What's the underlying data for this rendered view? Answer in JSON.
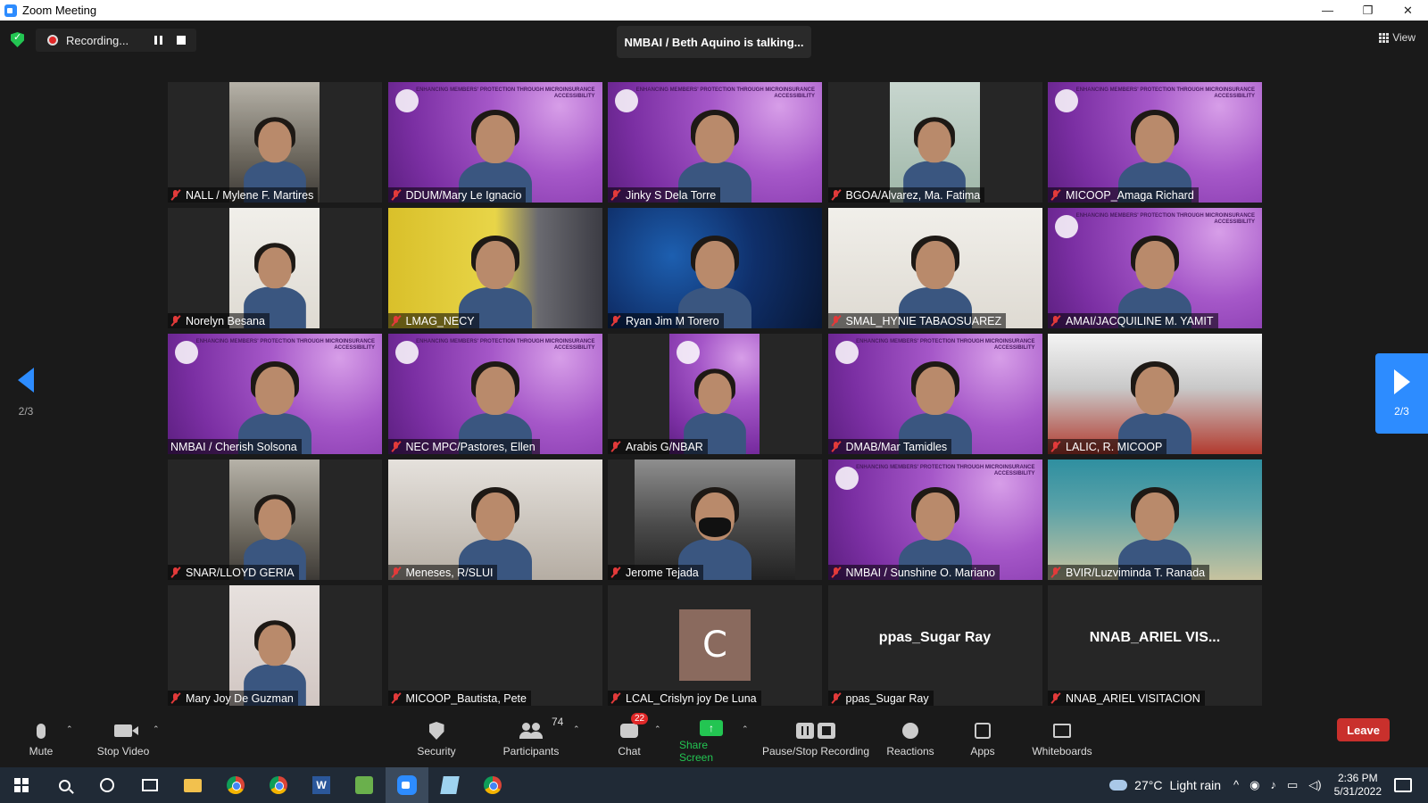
{
  "window": {
    "title": "Zoom Meeting",
    "controls": [
      "—",
      "❐",
      "✕"
    ]
  },
  "recording": {
    "label": "Recording..."
  },
  "talking": {
    "text": "NMBAI / Beth Aquino is talking..."
  },
  "view": {
    "label": "View"
  },
  "pagination": {
    "left_page": "2/3",
    "right_page": "2/3"
  },
  "participants": [
    {
      "name": "NALL / Mylene F. Martires",
      "muted": true,
      "bg": "office",
      "frame": "narrow"
    },
    {
      "name": "DDUM/Mary Le Ignacio",
      "muted": true,
      "bg": "purple",
      "frame": "full"
    },
    {
      "name": "Jinky S Dela Torre",
      "muted": true,
      "bg": "purple",
      "frame": "full"
    },
    {
      "name": "BGOA/Alvarez, Ma. Fatima",
      "muted": true,
      "bg": "mint",
      "frame": "narrow"
    },
    {
      "name": "MICOOP_Amaga Richard",
      "muted": true,
      "bg": "purple",
      "frame": "full"
    },
    {
      "name": "Norelyn Besana",
      "muted": true,
      "bg": "light",
      "frame": "narrow"
    },
    {
      "name": "LMAG_NECY",
      "muted": true,
      "bg": "yellow",
      "frame": "full"
    },
    {
      "name": "Ryan Jim M Torero",
      "muted": true,
      "bg": "tech",
      "frame": "full"
    },
    {
      "name": "SMAL_HYNIE TABAOSUAREZ",
      "muted": true,
      "bg": "light",
      "frame": "full"
    },
    {
      "name": "AMAI/JACQUILINE M. YAMIT",
      "muted": true,
      "bg": "purple",
      "frame": "full"
    },
    {
      "name": "NMBAI / Cherish Solsona",
      "muted": false,
      "bg": "purple",
      "frame": "full"
    },
    {
      "name": "NEC MPC/Pastores, Ellen",
      "muted": true,
      "bg": "purple",
      "frame": "full"
    },
    {
      "name": "Arabis G/NBAR",
      "muted": true,
      "bg": "purple",
      "frame": "narrow"
    },
    {
      "name": "DMAB/Mar Tamidles",
      "muted": true,
      "bg": "purple",
      "frame": "full"
    },
    {
      "name": "LALIC, R. MICOOP",
      "muted": true,
      "bg": "red",
      "frame": "full"
    },
    {
      "name": "SNAR/LLOYD GERIA",
      "muted": true,
      "bg": "office",
      "frame": "narrow"
    },
    {
      "name": "Meneses, R/SLUI",
      "muted": true,
      "bg": "room",
      "frame": "full"
    },
    {
      "name": "Jerome Tejada",
      "muted": true,
      "bg": "car",
      "frame": "mid"
    },
    {
      "name": "NMBAI / Sunshine O. Mariano",
      "muted": true,
      "bg": "purple",
      "frame": "full"
    },
    {
      "name": "BVIR/Luzviminda T. Ranada",
      "muted": true,
      "bg": "teal",
      "frame": "full"
    },
    {
      "name": "Mary Joy De Guzman",
      "muted": true,
      "bg": "pink",
      "frame": "narrow"
    },
    {
      "name": "MICOOP_Bautista, Pete",
      "muted": true,
      "bg": "none",
      "frame": "none"
    },
    {
      "name": "LCAL_Crislyn joy De Luna",
      "muted": true,
      "bg": "none",
      "frame": "avatar",
      "avatar_letter": "C"
    },
    {
      "name": "ppas_Sugar Ray",
      "muted": true,
      "bg": "none",
      "frame": "text",
      "center_text": "ppas_Sugar Ray"
    },
    {
      "name": "NNAB_ARIEL VISITACION",
      "muted": true,
      "bg": "none",
      "frame": "text",
      "center_text": "NNAB_ARIEL  VIS..."
    }
  ],
  "purple_banner": "ENHANCING MEMBERS' PROTECTION\nTHROUGH MICROINSURANCE ACCESSIBILITY",
  "toolbar": {
    "mute": "Mute",
    "stop_video": "Stop Video",
    "security": "Security",
    "participants": "Participants",
    "participants_count": "74",
    "chat": "Chat",
    "chat_badge": "22",
    "share_screen": "Share Screen",
    "pause_stop_recording": "Pause/Stop Recording",
    "reactions": "Reactions",
    "apps": "Apps",
    "whiteboards": "Whiteboards",
    "leave": "Leave"
  },
  "taskbar": {
    "weather_temp": "27°C",
    "weather_text": "Light rain",
    "time": "2:36 PM",
    "date": "5/31/2022"
  },
  "colors": {
    "accent": "#2d8cff",
    "leave": "#c9302c",
    "share": "#23c552",
    "muted": "#e23a3a"
  }
}
